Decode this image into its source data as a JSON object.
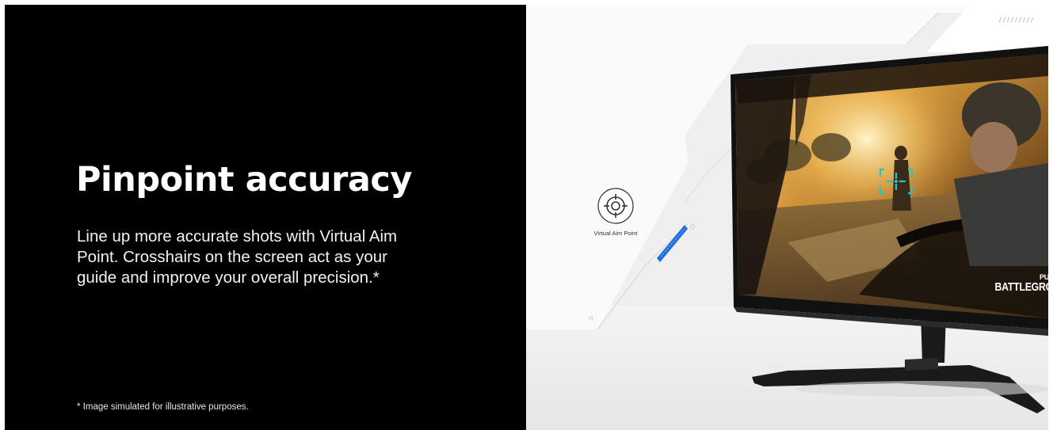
{
  "feature": {
    "headline": "Pinpoint accuracy",
    "description": "Line up more accurate shots with Virtual Aim Point. Crosshairs on the screen act as your guide and improve your overall precision.*",
    "disclaimer": "* Image simulated for illustrative purposes."
  },
  "product_image": {
    "aim_label": "Virtual Aim Point",
    "aim_icon": "crosshair-target-icon",
    "game_logo_top": "PUBG",
    "game_logo_bottom": "BATTLEGROUNDS"
  },
  "colors": {
    "text_panel_bg": "#000000",
    "accent_crosshair": "#22c6c6",
    "accent_stripe": "#1e6fd9"
  }
}
